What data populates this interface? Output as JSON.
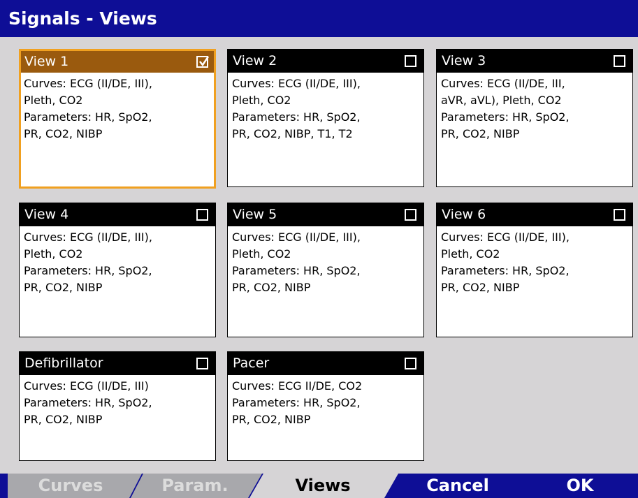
{
  "window": {
    "title": "Signals - Views"
  },
  "views": [
    {
      "name": "View 1",
      "checked": true,
      "lines": [
        "Curves: ECG (II/DE, III),",
        "Pleth, CO2",
        "Parameters: HR, SpO2,",
        "PR, CO2, NIBP"
      ]
    },
    {
      "name": "View 2",
      "checked": false,
      "lines": [
        "Curves: ECG (II/DE, III),",
        "Pleth, CO2",
        "Parameters: HR, SpO2,",
        "PR, CO2, NIBP, T1, T2"
      ]
    },
    {
      "name": "View 3",
      "checked": false,
      "lines": [
        "Curves: ECG (II/DE, III,",
        "aVR, aVL), Pleth, CO2",
        "Parameters: HR, SpO2,",
        "PR, CO2, NIBP"
      ]
    },
    {
      "name": "View 4",
      "checked": false,
      "lines": [
        "Curves: ECG (II/DE, III),",
        "Pleth, CO2",
        "Parameters: HR, SpO2,",
        "PR, CO2, NIBP"
      ]
    },
    {
      "name": "View 5",
      "checked": false,
      "lines": [
        "Curves: ECG (II/DE, III),",
        "Pleth, CO2",
        "Parameters: HR, SpO2,",
        "PR, CO2, NIBP"
      ]
    },
    {
      "name": "View 6",
      "checked": false,
      "lines": [
        "Curves: ECG (II/DE, III),",
        "Pleth, CO2",
        "Parameters: HR, SpO2,",
        "PR, CO2, NIBP"
      ]
    },
    {
      "name": "Defibrillator",
      "checked": false,
      "lines": [
        "Curves: ECG (II/DE, III)",
        "Parameters: HR, SpO2,",
        "PR, CO2, NIBP"
      ]
    },
    {
      "name": "Pacer",
      "checked": false,
      "lines": [
        "Curves: ECG II/DE, CO2",
        "Parameters: HR, SpO2,",
        "PR, CO2, NIBP"
      ]
    }
  ],
  "tabs": {
    "curves": "Curves",
    "param": "Param.",
    "views": "Views"
  },
  "buttons": {
    "cancel": "Cancel",
    "ok": "OK"
  },
  "colors": {
    "title_bar": "#0e0e96",
    "background": "#d6d4d6",
    "selected_border": "#f0a020",
    "selected_header": "#9a5a0e",
    "inactive_tab": "#a8a8ac",
    "active_tab": "#d6d4d6"
  },
  "icons": {
    "checkbox_checked": "checkmark-icon",
    "checkbox_unchecked": "empty-checkbox-icon"
  }
}
